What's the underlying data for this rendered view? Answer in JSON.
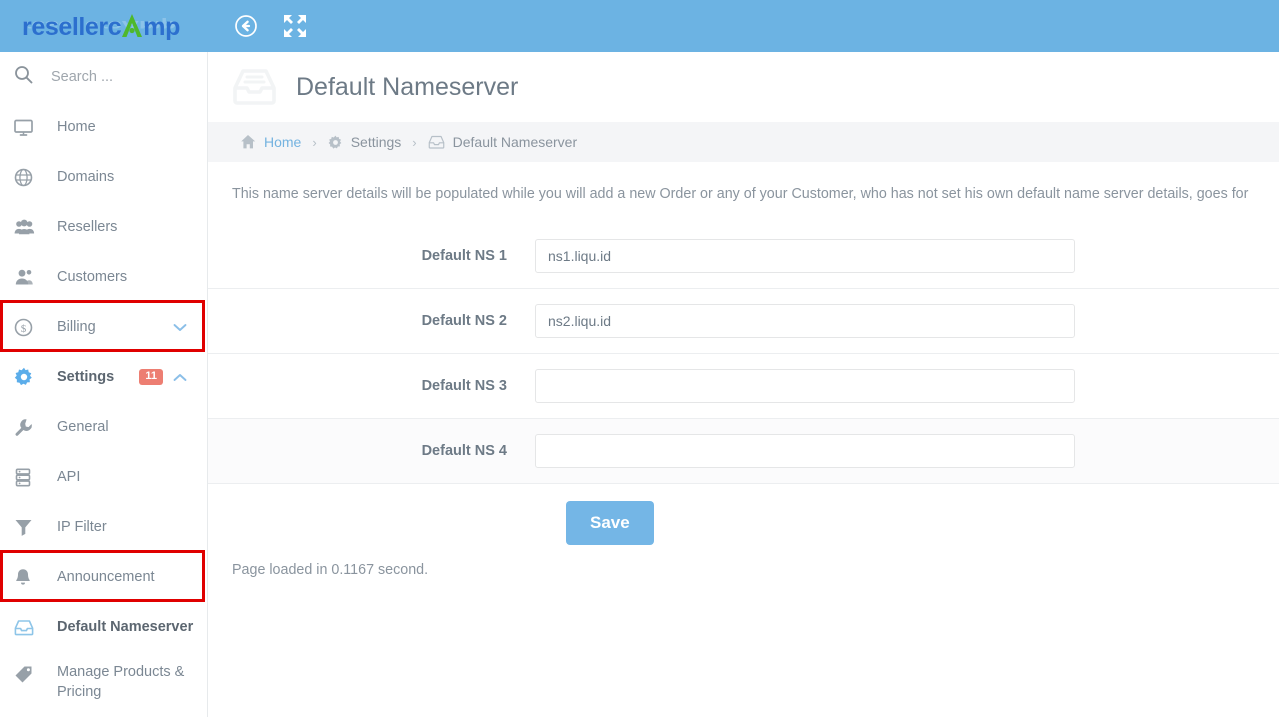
{
  "topbar": {
    "logo_part1": "resellerc",
    "logo_letter": "A",
    "logo_part2": "mp",
    "logo_full": "resellercAmp",
    "collapse_icon": "circle-arrow-left-icon",
    "fullscreen_icon": "fullscreen-expand-icon",
    "background_color": "#6cb3e3"
  },
  "sidebar": {
    "search": {
      "placeholder": "Search ...",
      "icon": "search-icon"
    },
    "items": [
      {
        "label": "Home",
        "icon": "monitor-icon"
      },
      {
        "label": "Domains",
        "icon": "globe-icon"
      },
      {
        "label": "Resellers",
        "icon": "group-users-icon"
      },
      {
        "label": "Customers",
        "icon": "user-icon"
      },
      {
        "label": "Billing",
        "icon": "dollar-circle-icon",
        "caret": "chevron-down-icon"
      },
      {
        "label": "Settings",
        "icon": "gear-icon",
        "badge": "11",
        "caret": "chevron-up-icon",
        "active_parent": true
      }
    ],
    "sub_items": [
      {
        "label": "General",
        "icon": "wrench-icon"
      },
      {
        "label": "API",
        "icon": "server-stack-icon"
      },
      {
        "label": "IP Filter",
        "icon": "funnel-icon"
      },
      {
        "label": "Announcement",
        "icon": "bell-icon"
      },
      {
        "label": "Default Nameserver",
        "icon": "inbox-icon",
        "active": true
      },
      {
        "label": "Manage Products & Pricing",
        "icon": "tag-icon"
      }
    ],
    "badge_color": "#ed7e72",
    "highlight_color": "#e00000"
  },
  "main": {
    "page_title": "Default Nameserver",
    "page_title_icon": "inbox-icon",
    "breadcrumb": [
      {
        "label": "Home",
        "icon": "home-icon",
        "is_link": true
      },
      {
        "label": "Settings",
        "icon": "gear-icon",
        "is_link": false
      },
      {
        "label": "Default Nameserver",
        "icon": "inbox-icon",
        "is_link": false
      }
    ],
    "breadcrumb_separator": "›",
    "intro_text": "This name server details will be populated while you will add a new Order or any of your Customer, who has not set his own default name server details, goes for",
    "form_rows": [
      {
        "label": "Default NS 1",
        "value": "ns1.liqu.id",
        "placeholder": ""
      },
      {
        "label": "Default NS 2",
        "value": "ns2.liqu.id",
        "placeholder": ""
      },
      {
        "label": "Default NS 3",
        "value": "",
        "placeholder": ""
      },
      {
        "label": "Default NS 4",
        "value": "",
        "placeholder": ""
      }
    ],
    "save_label": "Save",
    "save_color": "#74b6e6",
    "page_loaded_text": "Page loaded in 0.1167 second."
  }
}
